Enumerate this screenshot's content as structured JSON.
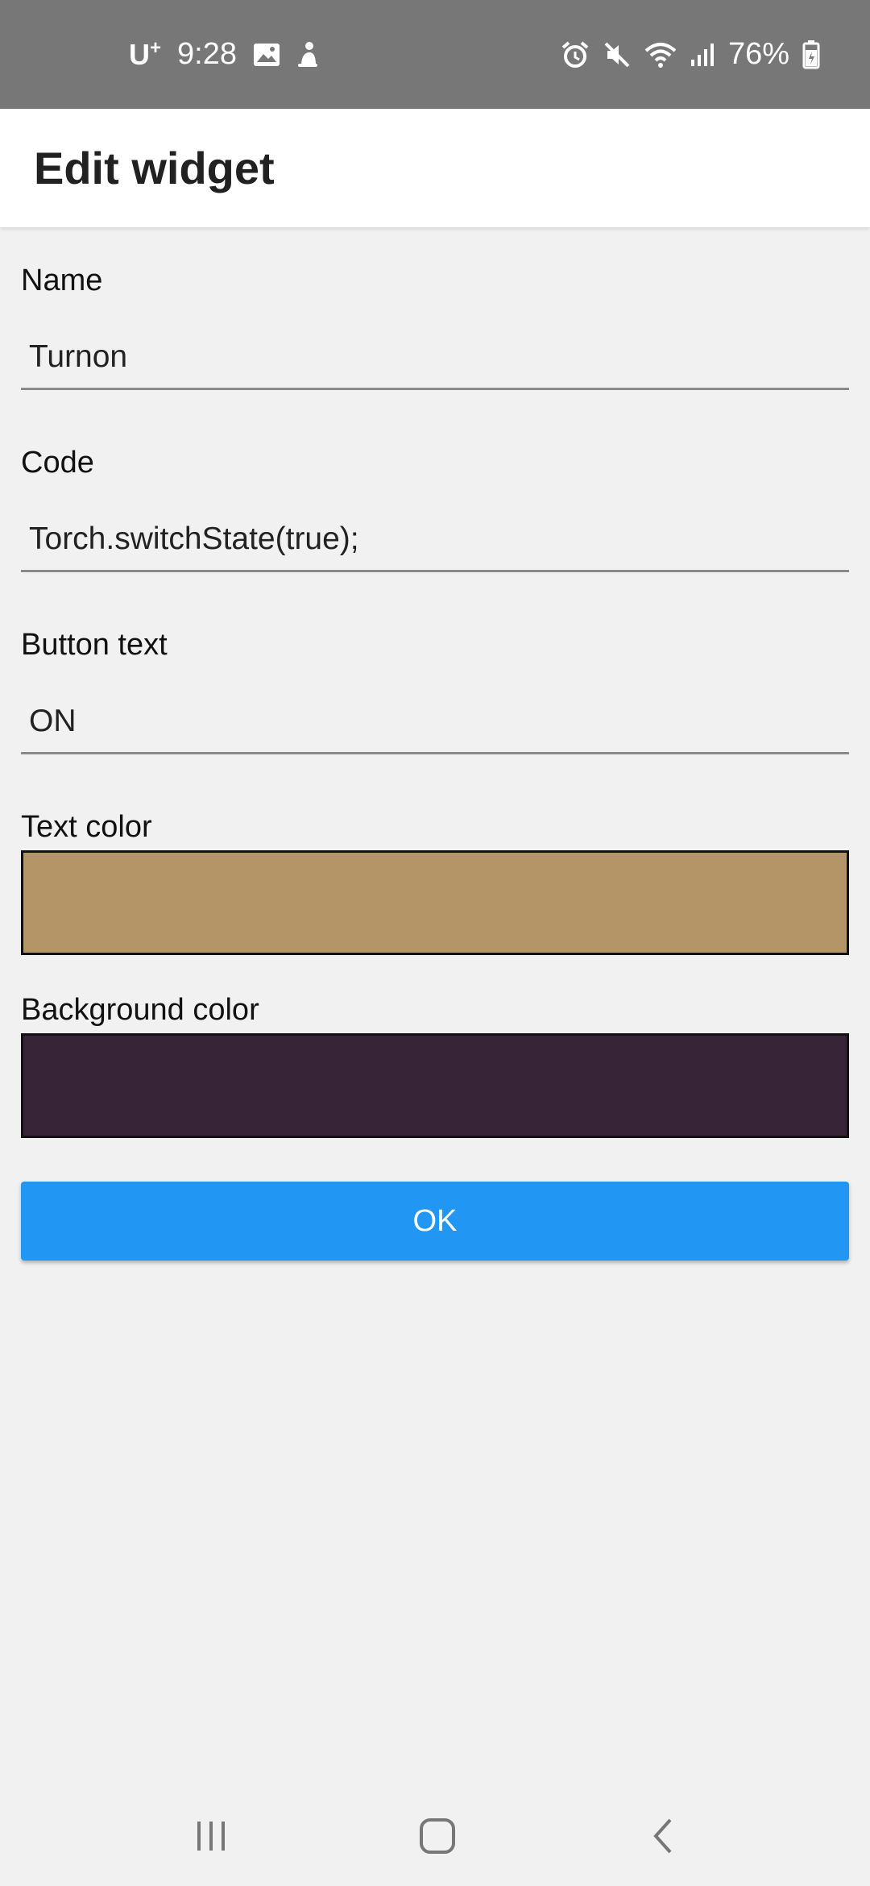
{
  "status_bar": {
    "carrier": "U",
    "carrier_sup": "+",
    "time": "9:28",
    "battery": "76%",
    "left_icons": [
      "image-icon",
      "notification-icon"
    ],
    "right_icons": [
      "alarm-icon",
      "mute-icon",
      "wifi-icon",
      "signal-icon",
      "battery-icon"
    ]
  },
  "app_bar": {
    "title": "Edit widget"
  },
  "form": {
    "name": {
      "label": "Name",
      "value": "Turnon"
    },
    "code": {
      "label": "Code",
      "value": "Torch.switchState(true);"
    },
    "button_text": {
      "label": "Button text",
      "value": "ON"
    },
    "text_color": {
      "label": "Text color",
      "color": "#b49567"
    },
    "background_color": {
      "label": "Background color",
      "color": "#372437"
    }
  },
  "ok_button": {
    "label": "OK",
    "color": "#2196f3"
  },
  "nav_bar": {
    "icons": [
      "recent-apps-icon",
      "home-icon",
      "back-icon"
    ]
  }
}
